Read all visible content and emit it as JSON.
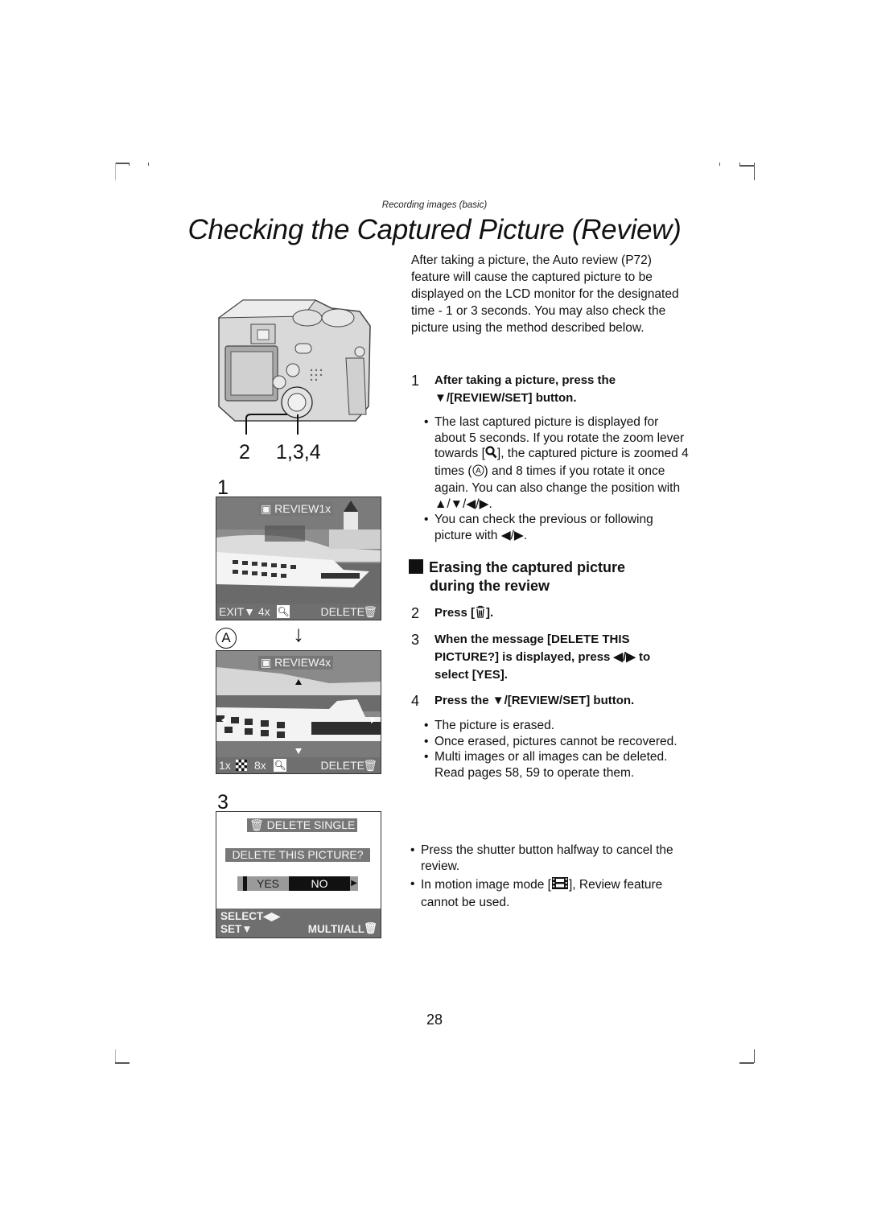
{
  "header": {
    "section": "Recording images (basic)",
    "title": "Checking the Captured Picture (Review)"
  },
  "intro": "After taking a picture, the Auto review (P72) feature will cause the captured picture to be displayed on the LCD monitor for the designated time - 1 or 3 seconds. You may also check the picture using the method described below.",
  "step1": {
    "number": "1",
    "line1": "After taking a picture, press the",
    "line2": "/[REVIEW/SET] button.",
    "bullets": [
      {
        "parts": [
          "The last captured picture is displayed for about 5 seconds. If you rotate the zoom lever towards [",
          "], the captured picture is zoomed 4 times (",
          ") and 8 times if you rotate it once again. You can also change the position with ▲/▼/◀/▶."
        ]
      },
      {
        "text": "You can check the previous or following picture with ◀/▶."
      }
    ]
  },
  "erase_section": {
    "title_line1": "Erasing the captured picture",
    "title_line2": "during the review",
    "steps": [
      {
        "number": "2",
        "before": "Press [",
        "after": "]."
      },
      {
        "number": "3",
        "text": "When the message [DELETE THIS PICTURE?] is displayed, press ◀/▶ to select [YES]."
      },
      {
        "number": "4",
        "before": "Press the ",
        "after": "/[REVIEW/SET] button."
      }
    ],
    "bullets": [
      "The picture is erased.",
      "Once erased, pictures cannot be recovered.",
      "Multi images or all images can be deleted. Read pages 58, 59 to operate them."
    ]
  },
  "notes": [
    {
      "text": "Press the shutter button halfway to cancel the review."
    },
    {
      "before": "In motion image mode [",
      "after": "], Review feature cannot be used."
    }
  ],
  "illustration": {
    "camera_callouts": [
      "2",
      "1,3,4"
    ],
    "screen1": {
      "label": "1",
      "osd_title": "REVIEW1x",
      "bar_left": "EXIT▼ 4x",
      "bar_right": "DELETE"
    },
    "screen_a": {
      "label": "A",
      "arrow": "↓",
      "osd_title": "REVIEW4x",
      "bar_left_1": "1x",
      "bar_left_2": "8x",
      "bar_right": "DELETE"
    },
    "screen3": {
      "label": "3",
      "mode": "DELETE SINGLE",
      "prompt": "DELETE THIS PICTURE?",
      "options": [
        "YES",
        "NO"
      ],
      "selected": "YES",
      "bar_line1": "SELECT◀▶",
      "bar_line2_left": "SET▼",
      "bar_line2_right": "MULTI/ALL"
    }
  },
  "circled_a": "A",
  "page_number": "28"
}
